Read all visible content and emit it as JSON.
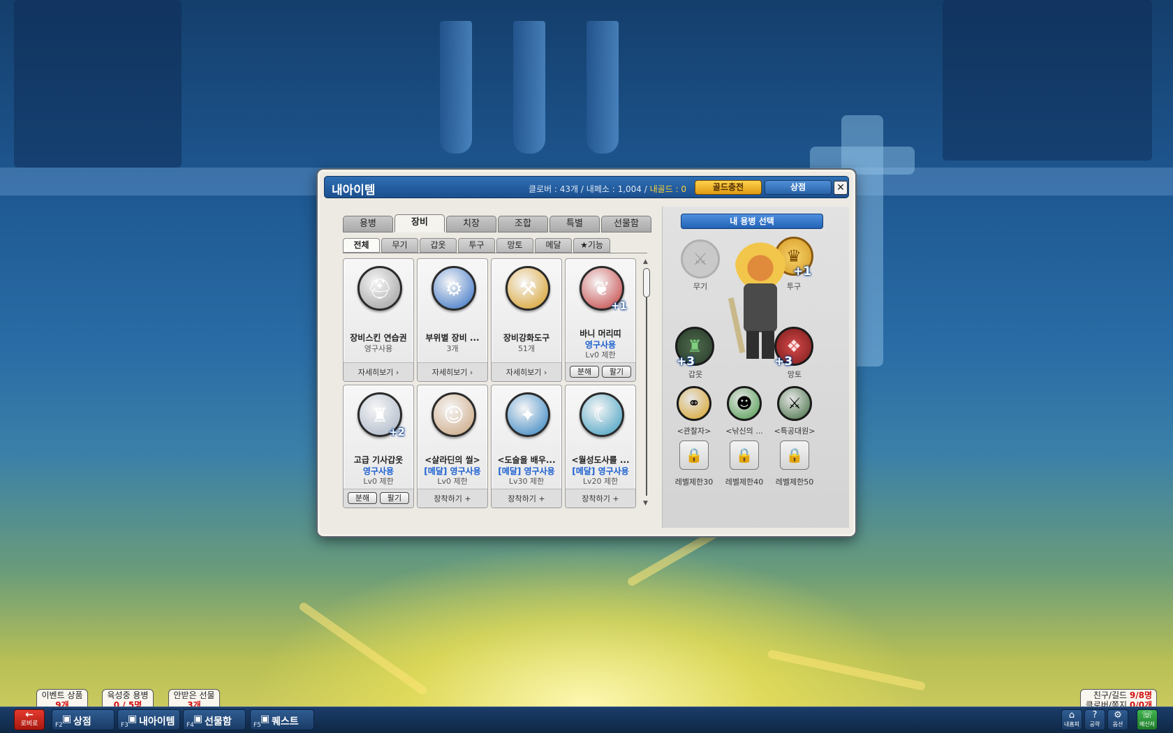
{
  "window": {
    "title": "내아이템",
    "currency_text": "클로버 : 43개  /  내페소 : 1,004  /",
    "gold_text": "내골드 : 0",
    "gold_charge_label": "골드충전",
    "shop_label": "상점",
    "close_label": "✕"
  },
  "tabs": [
    "용병",
    "장비",
    "치장",
    "조합",
    "특별",
    "선물함"
  ],
  "active_tab": "장비",
  "subtabs": [
    "전체",
    "무기",
    "갑옷",
    "투구",
    "망토",
    "메달",
    "★기능"
  ],
  "active_subtab": "전체",
  "items": [
    {
      "name": "장비스킨 연습권",
      "line1": "영구사용",
      "line1_blue": false,
      "line2": "",
      "plus": "",
      "footer": "자세히보기 ›",
      "buttons": [],
      "icon": "helmet-palette-icon",
      "color": "#9a9a9a",
      "glyph": "⛑"
    },
    {
      "name": "부위별 장비 ...",
      "line1": "3개",
      "line1_blue": false,
      "line2": "",
      "plus": "",
      "footer": "자세히보기 ›",
      "buttons": [],
      "icon": "blue-gear-icon",
      "color": "#2f6cc4",
      "glyph": "⚙"
    },
    {
      "name": "장비강화도구",
      "line1": "51개",
      "line1_blue": false,
      "line2": "",
      "plus": "",
      "footer": "자세히보기 ›",
      "buttons": [],
      "icon": "anvil-hammer-icon",
      "color": "#d79b1e",
      "glyph": "⚒"
    },
    {
      "name": "바니 머리띠",
      "line1": "영구사용",
      "line1_blue": true,
      "line2": "Lv0 제한",
      "plus": "+1",
      "footer": "",
      "buttons": [
        "분해",
        "팔기"
      ],
      "icon": "bunny-ears-icon",
      "color": "#c23a3a",
      "glyph": "❦"
    },
    {
      "name": "고급 기사갑옷",
      "line1": "영구사용",
      "line1_blue": true,
      "line2": "Lv0 제한",
      "plus": "+2",
      "footer": "",
      "buttons": [
        "분해",
        "팔기"
      ],
      "icon": "knight-armor-icon",
      "color": "#a8b4c6",
      "glyph": "♜"
    },
    {
      "name": "<살라딘의 씰>",
      "line1": "[메달] 영구사용",
      "line1_blue": true,
      "line2": "Lv0 제한",
      "plus": "",
      "footer": "장착하기 +",
      "buttons": [],
      "icon": "saladin-portrait-icon",
      "color": "#c9a27a",
      "glyph": "☺"
    },
    {
      "name": "<도술을 배우...",
      "line1": "[메달] 영구사용",
      "line1_blue": true,
      "line2": "Lv30 제한",
      "plus": "",
      "footer": "장착하기 +",
      "buttons": [],
      "icon": "taoist-medal-icon",
      "color": "#2d7fc0",
      "glyph": "✦"
    },
    {
      "name": "<월성도사를 ...",
      "line1": "[메달] 영구사용",
      "line1_blue": true,
      "line2": "Lv20 제한",
      "plus": "",
      "footer": "장착하기 +",
      "buttons": [],
      "icon": "moon-sage-medal-icon",
      "color": "#3a9bbf",
      "glyph": "☾"
    }
  ],
  "right_panel": {
    "select_label": "내 용병 선택",
    "weapon_label": "무기",
    "helmet_label": "투구",
    "armor_label": "갑옷",
    "cape_label": "망토",
    "helmet_plus": "+1",
    "armor_plus": "+3",
    "cape_plus": "+3",
    "pets": [
      {
        "label": "<관찰자>",
        "icon": "binoculars-icon",
        "color": "#d9a223",
        "glyph": "⚭"
      },
      {
        "label": "<낚신의 ...",
        "icon": "fishing-medal-icon",
        "color": "#4a9a4a",
        "glyph": "☻"
      },
      {
        "label": "<특공대원>",
        "icon": "blade-medal-icon",
        "color": "#3d6b3d",
        "glyph": "⚔"
      }
    ],
    "locks": [
      "레벨제한30",
      "레벨제한40",
      "레벨제한50"
    ]
  },
  "bottom": {
    "lobby_label": "로비로",
    "lobby_arrow": "←",
    "menu": [
      {
        "key": "F2",
        "label": "상점",
        "icon": "shop-icon",
        "glyph": "🛒"
      },
      {
        "key": "F3",
        "label": "내아이템",
        "icon": "bag-icon",
        "glyph": "✉"
      },
      {
        "key": "F4",
        "label": "선물함",
        "icon": "gift-icon",
        "glyph": "✉"
      },
      {
        "key": "F5",
        "label": "퀘스트",
        "icon": "quest-icon",
        "glyph": "✉"
      }
    ],
    "notices": [
      {
        "title": "이벤트 상품",
        "value": "9개"
      },
      {
        "title": "육성중 용병",
        "value": "0 / 5명"
      },
      {
        "title": "안받은 선물",
        "value": "3개"
      }
    ],
    "friend_line1_label": "친구/길드",
    "friend_line1_value": "9/8명",
    "friend_line2_label": "클로버/쪽지",
    "friend_line2_value": "0/0개",
    "sys_buttons": [
      {
        "label": "내홈피",
        "icon": "home-icon",
        "glyph": "⌂"
      },
      {
        "label": "공략",
        "icon": "guide-icon",
        "glyph": "?"
      },
      {
        "label": "옵션",
        "icon": "options-icon",
        "glyph": "⚙"
      },
      {
        "label": "메신저",
        "icon": "messenger-icon",
        "glyph": "☏"
      }
    ]
  }
}
